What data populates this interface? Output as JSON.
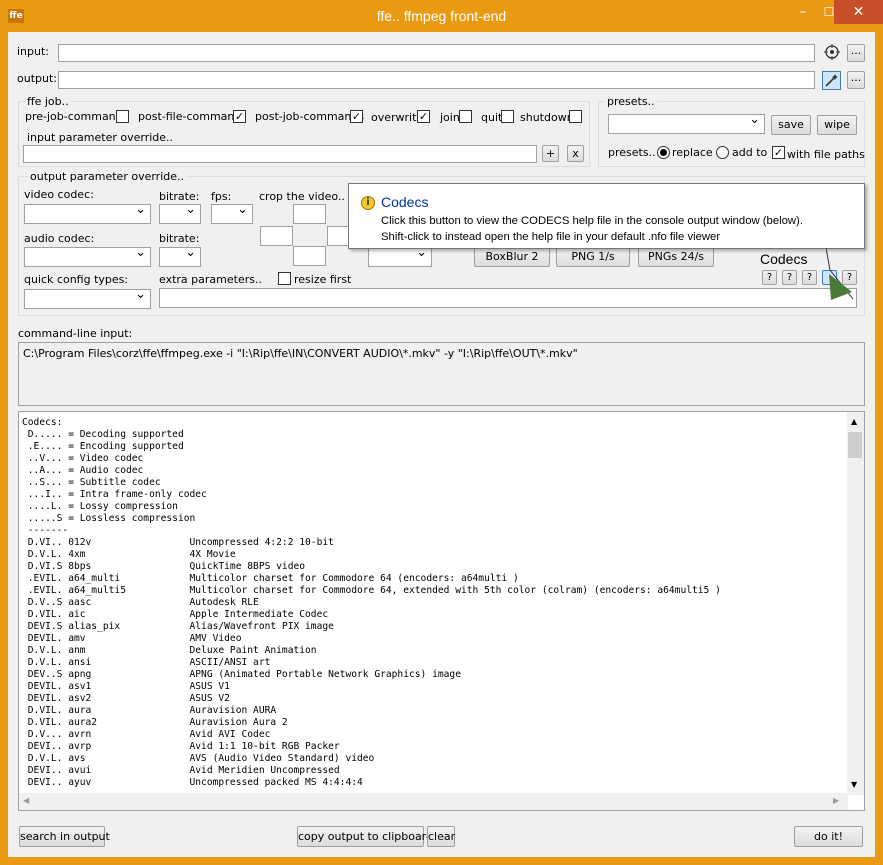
{
  "window": {
    "title": "ffe.. ffmpeg front-end",
    "icon_text": "ffe",
    "minimize_glyph": "–",
    "maximize_glyph": "☐",
    "close_glyph": "✕",
    "accent": "#e99a12"
  },
  "io": {
    "input_label": "input:",
    "input_value": "",
    "output_label": "output:",
    "output_value": "",
    "browse_label": "..."
  },
  "job": {
    "group_label": "ffe job..",
    "pre_job": {
      "label": "pre-job-commands",
      "checked": false
    },
    "post_file": {
      "label": "post-file-command",
      "checked": true
    },
    "post_job": {
      "label": "post-job-commands",
      "checked": true
    },
    "overwrite": {
      "label": "overwrite",
      "checked": true
    },
    "join": {
      "label": "join",
      "checked": false
    },
    "quit": {
      "label": "quit",
      "checked": false
    },
    "shutdown": {
      "label": "shutdown",
      "checked": false
    }
  },
  "input_override": {
    "label": "input parameter override..",
    "value": "",
    "plus": "+",
    "x": "x"
  },
  "presets": {
    "group_label": "presets..",
    "selected": "",
    "save": "save",
    "wipe": "wipe",
    "mode_label": "presets..",
    "replace": "replace",
    "add_to": "add to",
    "with_file_paths": "with file paths"
  },
  "output_override": {
    "group_label": "output parameter override..",
    "video_codec": "video codec:",
    "bitrate1": "bitrate:",
    "fps": "fps:",
    "crop": "crop the video..",
    "audio_codec": "audio codec:",
    "bitrate2": "bitrate:",
    "quick_config": "quick config types:",
    "extra_params": "extra parameters..",
    "resize_first": "resize first",
    "boxblur": "BoxBlur 2",
    "png1": "PNG 1/s",
    "png24": "PNGs 24/s",
    "codecs_label": "Codecs",
    "help_q": "?"
  },
  "tooltip": {
    "title": "Codecs",
    "line1": "Click this button to view the CODECS help file in the console output window (below).",
    "line2": "Shift-click to instead open the help file in your default .nfo file viewer"
  },
  "command": {
    "label": "command-line input:",
    "text": "C:\\Program Files\\corz\\ffe\\ffmpeg.exe  -i \"I:\\Rip\\ffe\\IN\\CONVERT AUDIO\\*.mkv\"  -y  \"I:\\Rip\\ffe\\OUT\\*.mkv\""
  },
  "output_lines": [
    "Codecs:",
    " D..... = Decoding supported",
    " .E.... = Encoding supported",
    " ..V... = Video codec",
    " ..A... = Audio codec",
    " ..S... = Subtitle codec",
    " ...I.. = Intra frame-only codec",
    " ....L. = Lossy compression",
    " .....S = Lossless compression",
    " -------",
    " D.VI.. 012v                 Uncompressed 4:2:2 10-bit",
    " D.V.L. 4xm                  4X Movie",
    " D.VI.S 8bps                 QuickTime 8BPS video",
    " .EVIL. a64_multi            Multicolor charset for Commodore 64 (encoders: a64multi )",
    " .EVIL. a64_multi5           Multicolor charset for Commodore 64, extended with 5th color (colram) (encoders: a64multi5 )",
    " D.V..S aasc                 Autodesk RLE",
    " D.VIL. aic                  Apple Intermediate Codec",
    " DEVI.S alias_pix            Alias/Wavefront PIX image",
    " DEVIL. amv                  AMV Video",
    " D.V.L. anm                  Deluxe Paint Animation",
    " D.V.L. ansi                 ASCII/ANSI art",
    " DEV..S apng                 APNG (Animated Portable Network Graphics) image",
    " DEVIL. asv1                 ASUS V1",
    " DEVIL. asv2                 ASUS V2",
    " D.VIL. aura                 Auravision AURA",
    " D.VIL. aura2                Auravision Aura 2",
    " D.V... avrn                 Avid AVI Codec",
    " DEVI.. avrp                 Avid 1:1 10-bit RGB Packer",
    " D.V.L. avs                  AVS (Audio Video Standard) video",
    " DEVI.. avui                 Avid Meridien Uncompressed",
    " DEVI.. ayuv                 Uncompressed packed MS 4:4:4:4"
  ],
  "bottom": {
    "search": "search in output",
    "copy": "copy output to clipboard",
    "clear": "clear",
    "doit": "do it!"
  }
}
